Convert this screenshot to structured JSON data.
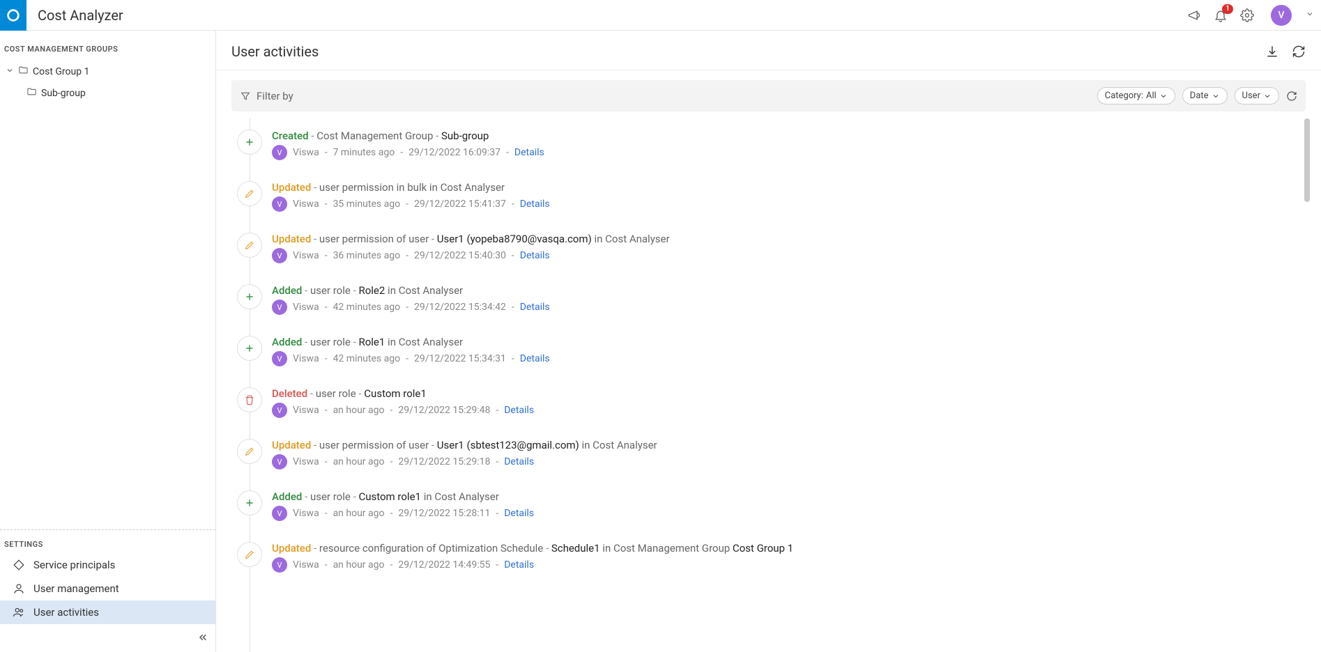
{
  "app": {
    "title": "Cost Analyzer"
  },
  "topbar": {
    "notif_badge": "1",
    "avatar_letter": "V"
  },
  "sidebar": {
    "groups_title": "COST MANAGEMENT GROUPS",
    "tree": {
      "root": "Cost Group 1",
      "child": "Sub-group"
    },
    "settings_title": "SETTINGS",
    "settings_items": [
      "Service principals",
      "User management",
      "User activities"
    ]
  },
  "main": {
    "title": "User activities"
  },
  "filter": {
    "label": "Filter by",
    "category_label": "Category:",
    "category_value": "All",
    "date_label": "Date",
    "user_label": "User"
  },
  "common": {
    "details": "Details",
    "dash": "-"
  },
  "activities": [
    {
      "type": "add",
      "action": "Created",
      "middle": "Cost Management Group",
      "target": "Sub-group",
      "suffix": "",
      "user_initial": "V",
      "user": "Viswa",
      "rel": "7 minutes ago",
      "ts": "29/12/2022 16:09:37"
    },
    {
      "type": "edit",
      "action": "Updated",
      "middle": "user permission in bulk in Cost Analyser",
      "target": "",
      "suffix": "",
      "user_initial": "V",
      "user": "Viswa",
      "rel": "35 minutes ago",
      "ts": "29/12/2022 15:41:37"
    },
    {
      "type": "edit",
      "action": "Updated",
      "middle": "user permission of user",
      "target": "User1 (yopeba8790@vasqa.com)",
      "suffix": "in Cost Analyser",
      "user_initial": "V",
      "user": "Viswa",
      "rel": "36 minutes ago",
      "ts": "29/12/2022 15:40:30"
    },
    {
      "type": "add",
      "action": "Added",
      "middle": "user role",
      "target": "Role2",
      "suffix": "in Cost Analyser",
      "user_initial": "V",
      "user": "Viswa",
      "rel": "42 minutes ago",
      "ts": "29/12/2022 15:34:42"
    },
    {
      "type": "add",
      "action": "Added",
      "middle": "user role",
      "target": "Role1",
      "suffix": "in Cost Analyser",
      "user_initial": "V",
      "user": "Viswa",
      "rel": "42 minutes ago",
      "ts": "29/12/2022 15:34:31"
    },
    {
      "type": "delete",
      "action": "Deleted",
      "middle": "user role",
      "target": "Custom role1",
      "suffix": "",
      "user_initial": "V",
      "user": "Viswa",
      "rel": "an hour ago",
      "ts": "29/12/2022 15:29:48"
    },
    {
      "type": "edit",
      "action": "Updated",
      "middle": "user permission of user",
      "target": "User1 (sbtest123@gmail.com)",
      "suffix": "in Cost Analyser",
      "user_initial": "V",
      "user": "Viswa",
      "rel": "an hour ago",
      "ts": "29/12/2022 15:29:18"
    },
    {
      "type": "add",
      "action": "Added",
      "middle": "user role",
      "target": "Custom role1",
      "suffix": "in Cost Analyser",
      "user_initial": "V",
      "user": "Viswa",
      "rel": "an hour ago",
      "ts": "29/12/2022 15:28:11"
    },
    {
      "type": "edit",
      "action": "Updated",
      "middle": "resource configuration of Optimization Schedule",
      "target": "Schedule1",
      "suffix": "in Cost Management Group",
      "suffix_strong": "Cost Group 1",
      "user_initial": "V",
      "user": "Viswa",
      "rel": "an hour ago",
      "ts": "29/12/2022 14:49:55"
    }
  ]
}
